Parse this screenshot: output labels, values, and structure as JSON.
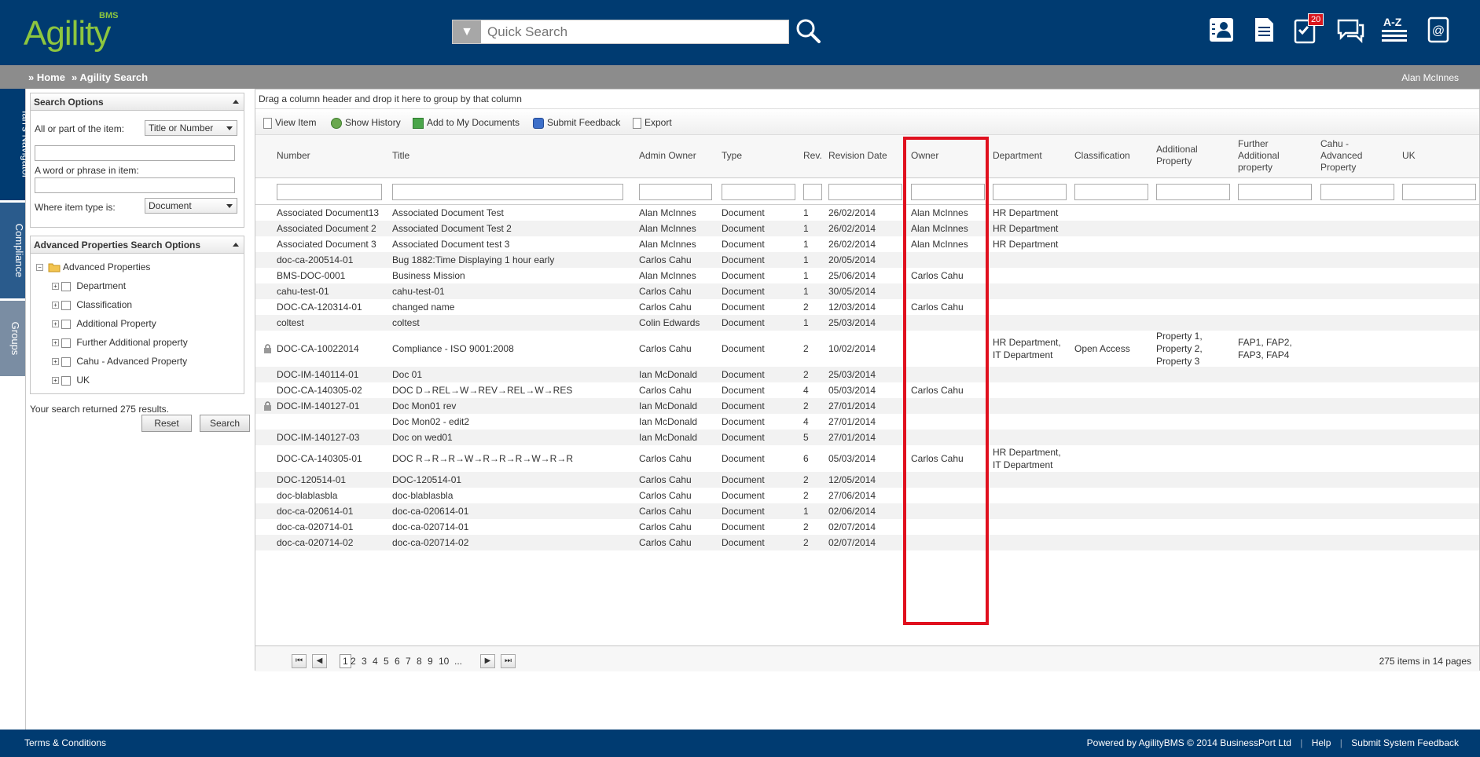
{
  "app": {
    "logo_text": "Agility",
    "logo_sup": "BMS"
  },
  "search": {
    "placeholder": "Quick Search"
  },
  "top_icons": {
    "notification_count": "20",
    "az_label": "A-Z"
  },
  "breadcrumb": {
    "home": "» Home",
    "current": "» Agility Search"
  },
  "user": {
    "name": "Alan McInnes"
  },
  "side_tabs": [
    "Ian's Navigator",
    "Compliance",
    "Groups"
  ],
  "search_options": {
    "title": "Search Options",
    "item_label": "All or part of the item:",
    "item_select": "Title or Number",
    "phrase_label": "A word or phrase in item:",
    "type_label": "Where item type is:",
    "type_select": "Document"
  },
  "advanced": {
    "title": "Advanced Properties Search Options",
    "root": "Advanced Properties",
    "items": [
      "Department",
      "Classification",
      "Additional Property",
      "Further Additional property",
      "Cahu - Advanced Property",
      "UK"
    ]
  },
  "results_text": "Your search returned 275 results.",
  "buttons": {
    "reset": "Reset",
    "search": "Search"
  },
  "grid": {
    "group_hint": "Drag a column header and drop it here to group by that column",
    "toolbar": [
      "View Item",
      "Show History",
      "Add to My Documents",
      "Submit Feedback",
      "Export"
    ],
    "columns": [
      "Number",
      "Title",
      "Admin Owner",
      "Type",
      "Rev.",
      "Revision Date",
      "Owner",
      "Department",
      "Classification",
      "Additional Property",
      "Further Additional property",
      "Cahu - Advanced Property",
      "UK"
    ],
    "rows": [
      {
        "lock": false,
        "number": "Associated Document13",
        "title": "Associated Document Test",
        "admin": "Alan McInnes",
        "type": "Document",
        "rev": "1",
        "date": "26/02/2014",
        "owner": "Alan McInnes",
        "dept": "HR Department",
        "cls": "",
        "addl": "",
        "further": ""
      },
      {
        "lock": false,
        "number": "Associated Document 2",
        "title": "Associated Document Test 2",
        "admin": "Alan McInnes",
        "type": "Document",
        "rev": "1",
        "date": "26/02/2014",
        "owner": "Alan McInnes",
        "dept": "HR Department",
        "cls": "",
        "addl": "",
        "further": ""
      },
      {
        "lock": false,
        "number": "Associated Document 3",
        "title": "Associated Document test 3",
        "admin": "Alan McInnes",
        "type": "Document",
        "rev": "1",
        "date": "26/02/2014",
        "owner": "Alan McInnes",
        "dept": "HR Department",
        "cls": "",
        "addl": "",
        "further": ""
      },
      {
        "lock": false,
        "number": "doc-ca-200514-01",
        "title": "Bug 1882:Time Displaying 1 hour early",
        "admin": "Carlos Cahu",
        "type": "Document",
        "rev": "1",
        "date": "20/05/2014",
        "owner": "",
        "dept": "",
        "cls": "",
        "addl": "",
        "further": ""
      },
      {
        "lock": false,
        "number": "BMS-DOC-0001",
        "title": "Business Mission",
        "admin": "Alan McInnes",
        "type": "Document",
        "rev": "1",
        "date": "25/06/2014",
        "owner": "Carlos Cahu",
        "dept": "",
        "cls": "",
        "addl": "",
        "further": ""
      },
      {
        "lock": false,
        "number": "cahu-test-01",
        "title": "cahu-test-01",
        "admin": "Carlos Cahu",
        "type": "Document",
        "rev": "1",
        "date": "30/05/2014",
        "owner": "",
        "dept": "",
        "cls": "",
        "addl": "",
        "further": ""
      },
      {
        "lock": false,
        "number": "DOC-CA-120314-01",
        "title": "changed name",
        "admin": "Carlos Cahu",
        "type": "Document",
        "rev": "2",
        "date": "12/03/2014",
        "owner": "Carlos Cahu",
        "dept": "",
        "cls": "",
        "addl": "",
        "further": ""
      },
      {
        "lock": false,
        "number": "coltest",
        "title": "coltest",
        "admin": "Colin Edwards",
        "type": "Document",
        "rev": "1",
        "date": "25/03/2014",
        "owner": "",
        "dept": "",
        "cls": "",
        "addl": "",
        "further": ""
      },
      {
        "lock": true,
        "number": "DOC-CA-10022014",
        "title": "Compliance - ISO 9001:2008",
        "admin": "Carlos Cahu",
        "type": "Document",
        "rev": "2",
        "date": "10/02/2014",
        "owner": "",
        "dept": "HR Department,\nIT Department",
        "cls": "Open Access",
        "addl": "Property 1,\nProperty 2,\nProperty 3",
        "further": "FAP1, FAP2,\nFAP3, FAP4"
      },
      {
        "lock": false,
        "number": "DOC-IM-140114-01",
        "title": "Doc 01",
        "admin": "Ian McDonald",
        "type": "Document",
        "rev": "2",
        "date": "25/03/2014",
        "owner": "",
        "dept": "",
        "cls": "",
        "addl": "",
        "further": ""
      },
      {
        "lock": false,
        "number": "DOC-CA-140305-02",
        "title": "DOC D→REL→W→REV→REL→W→RES",
        "admin": "Carlos Cahu",
        "type": "Document",
        "rev": "4",
        "date": "05/03/2014",
        "owner": "Carlos Cahu",
        "dept": "",
        "cls": "",
        "addl": "",
        "further": ""
      },
      {
        "lock": true,
        "number": "DOC-IM-140127-01",
        "title": "Doc Mon01 rev",
        "admin": "Ian McDonald",
        "type": "Document",
        "rev": "2",
        "date": "27/01/2014",
        "owner": "",
        "dept": "",
        "cls": "",
        "addl": "",
        "further": ""
      },
      {
        "lock": false,
        "number": "",
        "title": "Doc Mon02 - edit2",
        "admin": "Ian McDonald",
        "type": "Document",
        "rev": "4",
        "date": "27/01/2014",
        "owner": "",
        "dept": "",
        "cls": "",
        "addl": "",
        "further": ""
      },
      {
        "lock": false,
        "number": "DOC-IM-140127-03",
        "title": "Doc on wed01",
        "admin": "Ian McDonald",
        "type": "Document",
        "rev": "5",
        "date": "27/01/2014",
        "owner": "",
        "dept": "",
        "cls": "",
        "addl": "",
        "further": ""
      },
      {
        "lock": false,
        "number": "DOC-CA-140305-01",
        "title": "DOC R→R→R→W→R→R→R→W→R→R",
        "admin": "Carlos Cahu",
        "type": "Document",
        "rev": "6",
        "date": "05/03/2014",
        "owner": "Carlos Cahu",
        "dept": "HR Department,\nIT Department",
        "cls": "",
        "addl": "",
        "further": ""
      },
      {
        "lock": false,
        "number": "DOC-120514-01",
        "title": "DOC-120514-01",
        "admin": "Carlos Cahu",
        "type": "Document",
        "rev": "2",
        "date": "12/05/2014",
        "owner": "",
        "dept": "",
        "cls": "",
        "addl": "",
        "further": ""
      },
      {
        "lock": false,
        "number": "doc-blablasbla",
        "title": "doc-blablasbla",
        "admin": "Carlos Cahu",
        "type": "Document",
        "rev": "2",
        "date": "27/06/2014",
        "owner": "",
        "dept": "",
        "cls": "",
        "addl": "",
        "further": ""
      },
      {
        "lock": false,
        "number": "doc-ca-020614-01",
        "title": "doc-ca-020614-01",
        "admin": "Carlos Cahu",
        "type": "Document",
        "rev": "1",
        "date": "02/06/2014",
        "owner": "",
        "dept": "",
        "cls": "",
        "addl": "",
        "further": ""
      },
      {
        "lock": false,
        "number": "doc-ca-020714-01",
        "title": "doc-ca-020714-01",
        "admin": "Carlos Cahu",
        "type": "Document",
        "rev": "2",
        "date": "02/07/2014",
        "owner": "",
        "dept": "",
        "cls": "",
        "addl": "",
        "further": ""
      },
      {
        "lock": false,
        "number": "doc-ca-020714-02",
        "title": "doc-ca-020714-02",
        "admin": "Carlos Cahu",
        "type": "Document",
        "rev": "2",
        "date": "02/07/2014",
        "owner": "",
        "dept": "",
        "cls": "",
        "addl": "",
        "further": ""
      }
    ],
    "pager": {
      "pages": [
        "1",
        "2",
        "3",
        "4",
        "5",
        "6",
        "7",
        "8",
        "9",
        "10",
        "..."
      ],
      "current": "1",
      "summary": "275 items in 14 pages"
    }
  },
  "footer": {
    "terms": "Terms & Conditions",
    "powered": "Powered by AgilityBMS © 2014 BusinessPort Ltd",
    "help": "Help",
    "feedback": "Submit System Feedback"
  },
  "colors": {
    "header": "#003b71",
    "breadcrumb": "#8c8c8c",
    "logo": "#8dc63f",
    "highlight": "#e0101e",
    "tab": "#003b71",
    "tab_inactive": "#7a8da3"
  }
}
